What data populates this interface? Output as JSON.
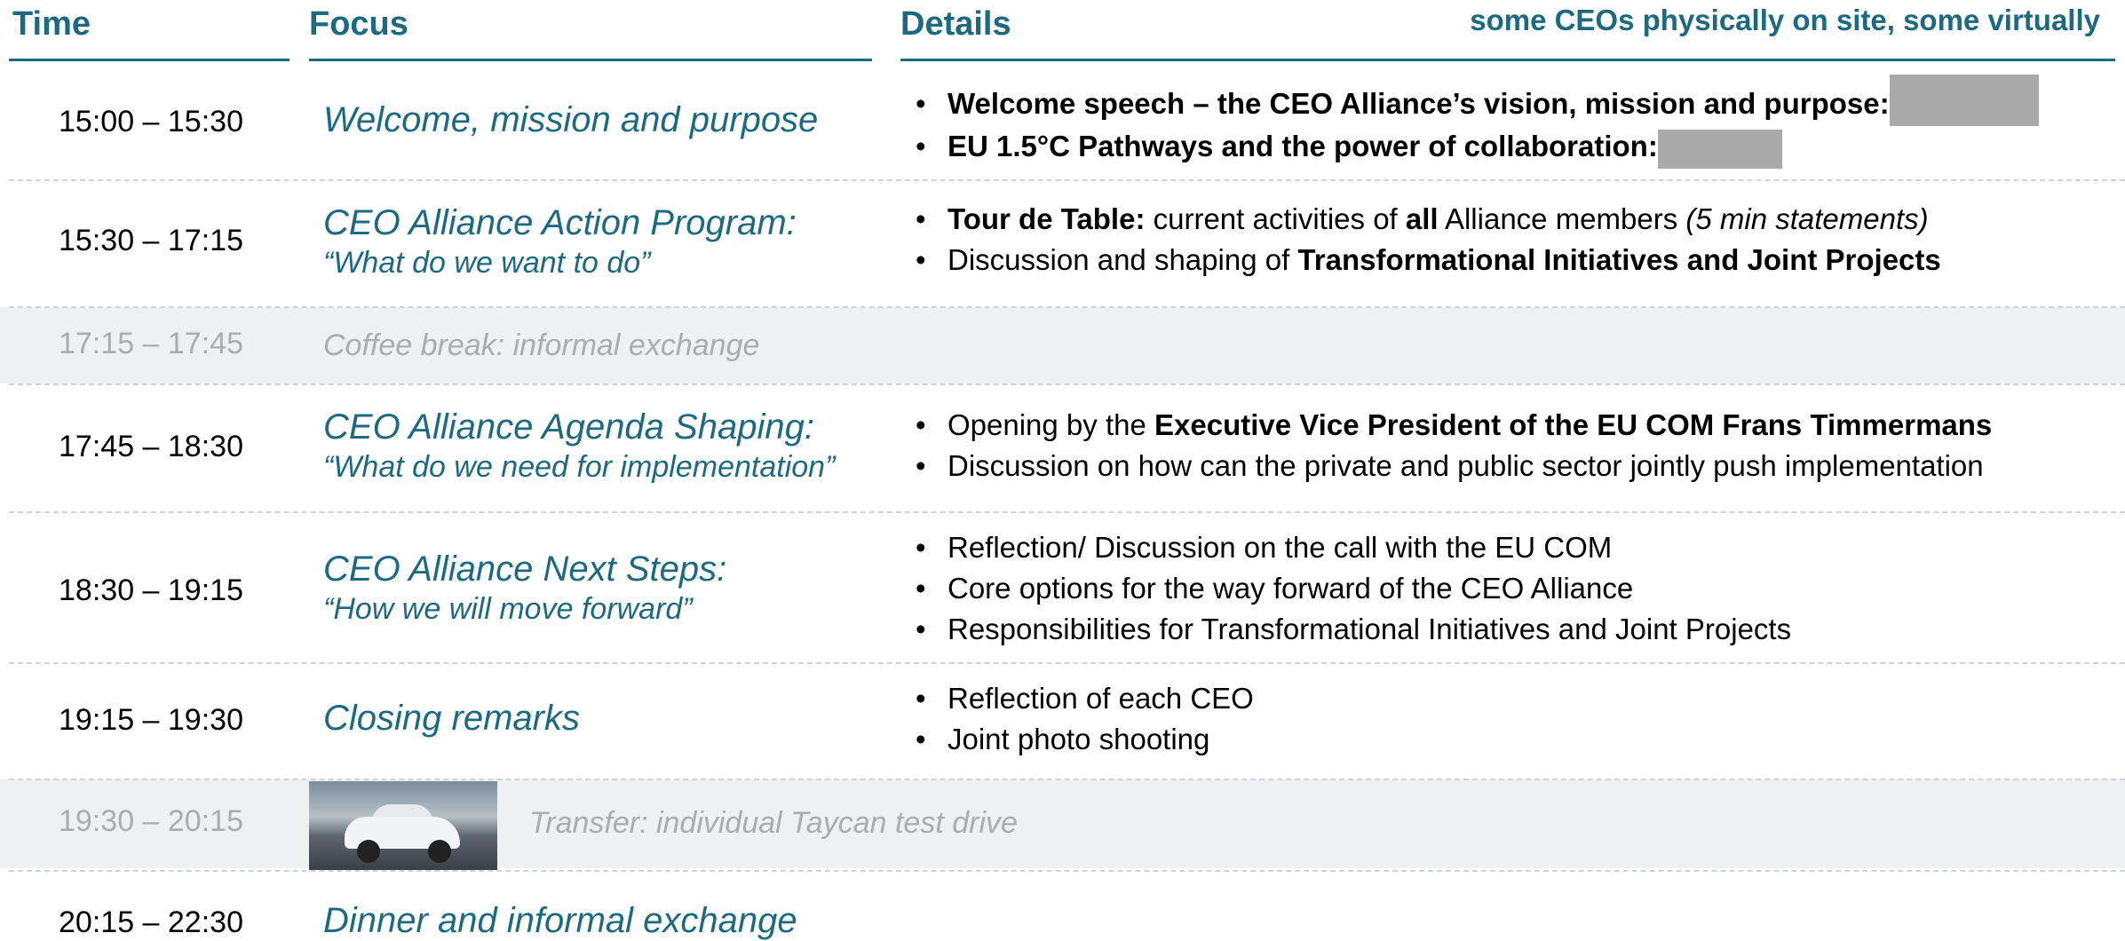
{
  "header": {
    "time_label": "Time",
    "focus_label": "Focus",
    "details_label": "Details",
    "note": "some CEOs physically on site, some virtually"
  },
  "rows": [
    {
      "time": "15:00 – 15:30",
      "focus": "Welcome, mission and purpose",
      "details": [
        {
          "bold": "Welcome speech – the CEO Alliance’s vision, mission and purpose:",
          "rest": ""
        },
        {
          "bold": "EU 1.5°C Pathways and the power of collaboration:",
          "rest": ""
        }
      ]
    },
    {
      "time": "15:30 – 17:15",
      "focus": "CEO Alliance Action Program:",
      "focus_sub": "“What do we want to do”",
      "details": [
        {
          "pre": "",
          "bold": "Tour de Table:",
          "mid": " current activities of ",
          "bold2": "all",
          "post": " Alliance members ",
          "italic": "(5 min statements)"
        },
        {
          "pre": "Discussion and shaping of ",
          "bold": "Transformational Initiatives and Joint Projects"
        }
      ]
    },
    {
      "time": "17:15 – 17:45",
      "focus": "Coffee break: informal exchange"
    },
    {
      "time": "17:45 – 18:30",
      "focus": "CEO Alliance Agenda Shaping:",
      "focus_sub": "“What do we need for implementation”",
      "details": [
        {
          "pre": "Opening by the ",
          "bold": "Executive Vice President of the EU COM Frans Timmermans"
        },
        {
          "pre": "Discussion on how can the private and public sector jointly push implementation"
        }
      ]
    },
    {
      "time": "18:30 – 19:15",
      "focus": "CEO Alliance Next Steps:",
      "focus_sub": "“How we will move forward”",
      "details": [
        {
          "pre": "Reflection/ Discussion on the call with the EU COM"
        },
        {
          "pre": "Core options for the way forward of the CEO Alliance"
        },
        {
          "pre": "Responsibilities for Transformational Initiatives and Joint Projects"
        }
      ]
    },
    {
      "time": "19:15 – 19:30",
      "focus": "Closing remarks",
      "details": [
        {
          "pre": "Reflection of each CEO"
        },
        {
          "pre": "Joint photo shooting"
        }
      ]
    },
    {
      "time": "19:30 – 20:15",
      "focus": "Transfer: individual Taycan test drive"
    },
    {
      "time": "20:15 – 22:30",
      "focus": "Dinner and informal exchange"
    }
  ],
  "colors": {
    "accent": "#1d6a80",
    "muted_text": "#a8adb2",
    "grey_row": "#eef0f2",
    "redaction": "#a9a9a9"
  }
}
